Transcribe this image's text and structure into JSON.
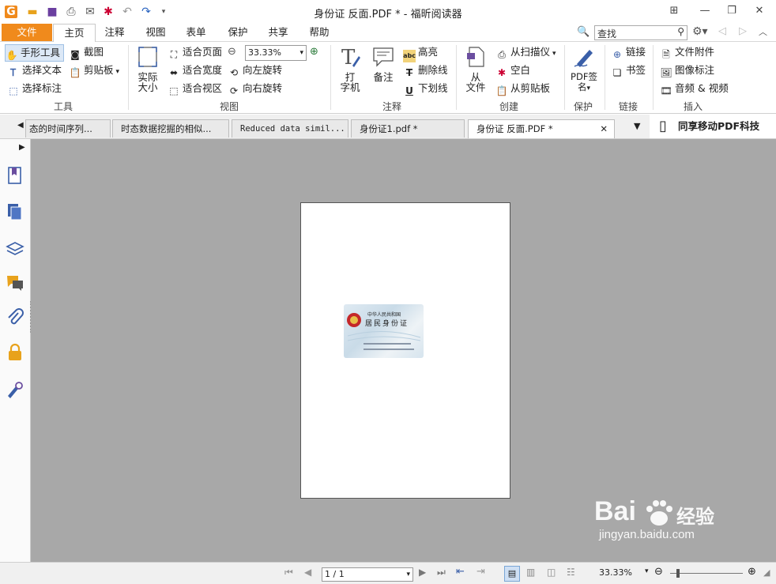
{
  "window": {
    "title": "身份证 反面.PDF * - 福昕阅读器"
  },
  "menu": {
    "tabs": [
      "文件",
      "主页",
      "注释",
      "视图",
      "表单",
      "保护",
      "共享",
      "帮助"
    ],
    "search_placeholder": "查找"
  },
  "ribbon": {
    "tools": {
      "hand": "手形工具",
      "select_text": "选择文本",
      "select_annot": "选择标注",
      "snapshot": "截图",
      "clipboard": "剪贴板",
      "label": "工具"
    },
    "view": {
      "actual_size": "实际\n大小",
      "fit_page": "适合页面",
      "fit_width": "适合宽度",
      "fit_visible": "适合视区",
      "zoom": "33.33%",
      "rotate_left": "向左旋转",
      "rotate_right": "向右旋转",
      "label": "视图"
    },
    "comment": {
      "typewriter_1": "打",
      "typewriter_2": "字机",
      "note": "备注",
      "highlight": "高亮",
      "strikeout": "删除线",
      "underline": "下划线",
      "label": "注释"
    },
    "create": {
      "from_file_1": "从",
      "from_file_2": "文件",
      "from_scanner": "从扫描仪",
      "blank": "空白",
      "from_clipboard": "从剪贴板",
      "label": "创建"
    },
    "protect": {
      "pdf_sign_1": "PDF签",
      "pdf_sign_2": "名",
      "label": "保护"
    },
    "links": {
      "link": "链接",
      "bookmark": "书签",
      "label": "链接"
    },
    "insert": {
      "file_attachment": "文件附件",
      "image_annot": "图像标注",
      "audio_video": "音频 & 视频",
      "label": "插入"
    }
  },
  "doc_tabs": [
    {
      "label": "态的时间序列..."
    },
    {
      "label": "时态数据挖掘的相似..."
    },
    {
      "label": "Reduced data simil..."
    },
    {
      "label": "身份证1.pdf *"
    },
    {
      "label": "身份证 反面.PDF *"
    }
  ],
  "promo": "同享移动PDF科技",
  "idcard": {
    "line1": "中华人民共和国",
    "line2": "居民身份证"
  },
  "status": {
    "page": "1 / 1",
    "zoom": "33.33%"
  },
  "watermark": {
    "brand": "Bai",
    "brand2": "经验",
    "url": "jingyan.baidu.com"
  },
  "colors": {
    "accent": "#f08a1c",
    "doc_bg": "#a8a8a8",
    "icon_blue": "#3a5fa8",
    "icon_purple": "#6b4ea0"
  }
}
